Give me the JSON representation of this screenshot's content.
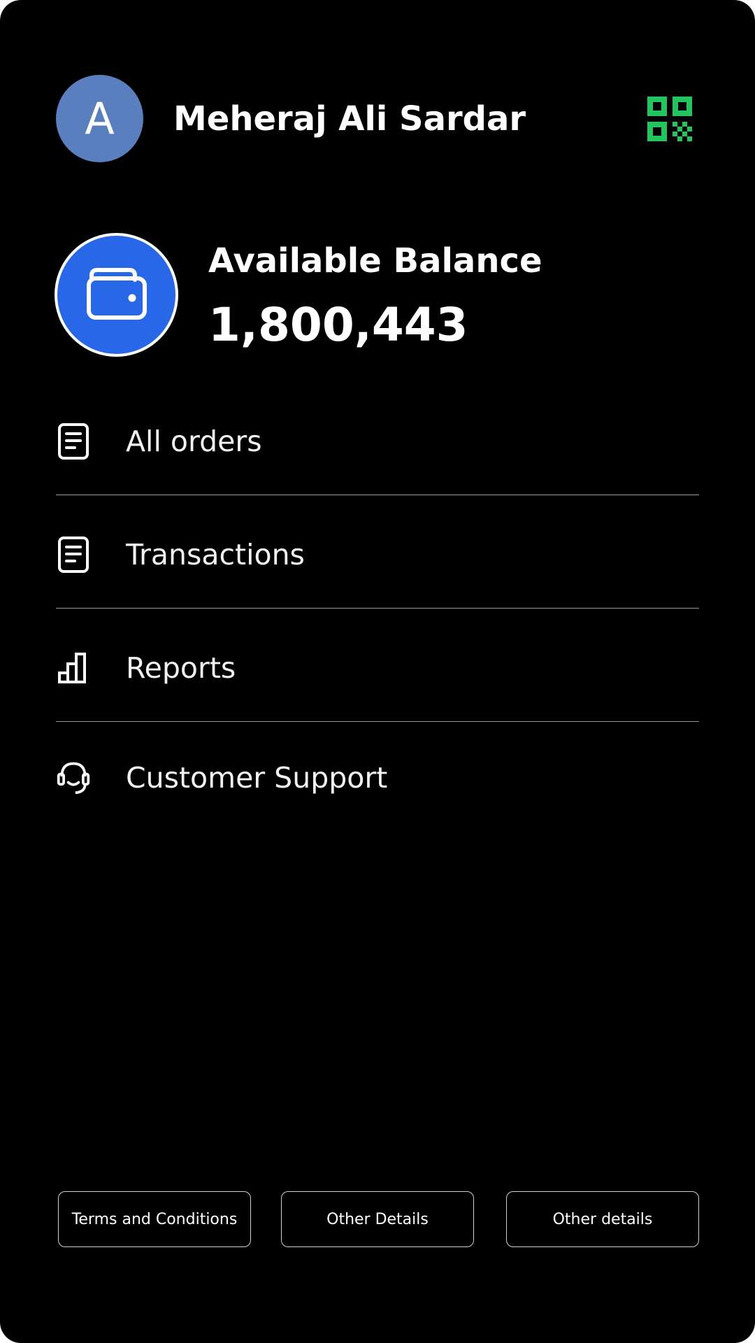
{
  "user": {
    "initial": "A",
    "name": "Meheraj Ali Sardar",
    "avatar_color": "#5a7fbf"
  },
  "header": {
    "qr_icon": "qr-code-icon",
    "qr_color": "#22c55e"
  },
  "balance": {
    "label": "Available Balance",
    "value": "1,800,443",
    "icon": "wallet-icon",
    "circle_color": "#2767e8"
  },
  "menu": {
    "items": [
      {
        "label": "All orders",
        "icon": "document-icon"
      },
      {
        "label": "Transactions",
        "icon": "document-icon"
      },
      {
        "label": "Reports",
        "icon": "bar-chart-icon"
      },
      {
        "label": "Customer Support",
        "icon": "headset-icon"
      }
    ]
  },
  "footer": {
    "buttons": [
      {
        "label": "Terms and Conditions"
      },
      {
        "label": "Other Details"
      },
      {
        "label": "Other details"
      }
    ]
  }
}
